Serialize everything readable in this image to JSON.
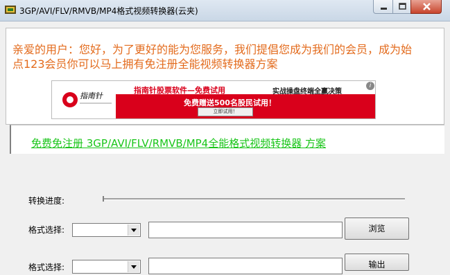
{
  "window": {
    "title": "3GP/AVI/FLV/RMVB/MP4格式视频转换器(云夹)"
  },
  "info": {
    "notice": "亲爱的用户：您好，为了更好的能为您服务，我们提倡您成为我们的会员，成为始点123会员你可以马上拥有免注册全能视频转换器方案",
    "banner": {
      "headline": "指南针股票软件—免费试用",
      "slogan": "实战操盘终端全赢决策",
      "offer": "免费赠送500名股民试用！",
      "button": "立即试用！",
      "info_mark": "i"
    },
    "link": "免费免注册 3GP/AVI/FLV/RMVB/MP4全能格式视频转换器 方案"
  },
  "form": {
    "progress_label": "转换进度:",
    "progress": 0,
    "format_label_1": "格式选择:",
    "format_value_1": "",
    "input_path": "",
    "browse_button": "浏览",
    "format_label_2": "格式选择:",
    "format_value_2": "",
    "output_path": "",
    "output_button": "输出"
  },
  "colors": {
    "notice": "#e36b1d",
    "link": "#19c519",
    "banner_red": "#d9001b"
  }
}
